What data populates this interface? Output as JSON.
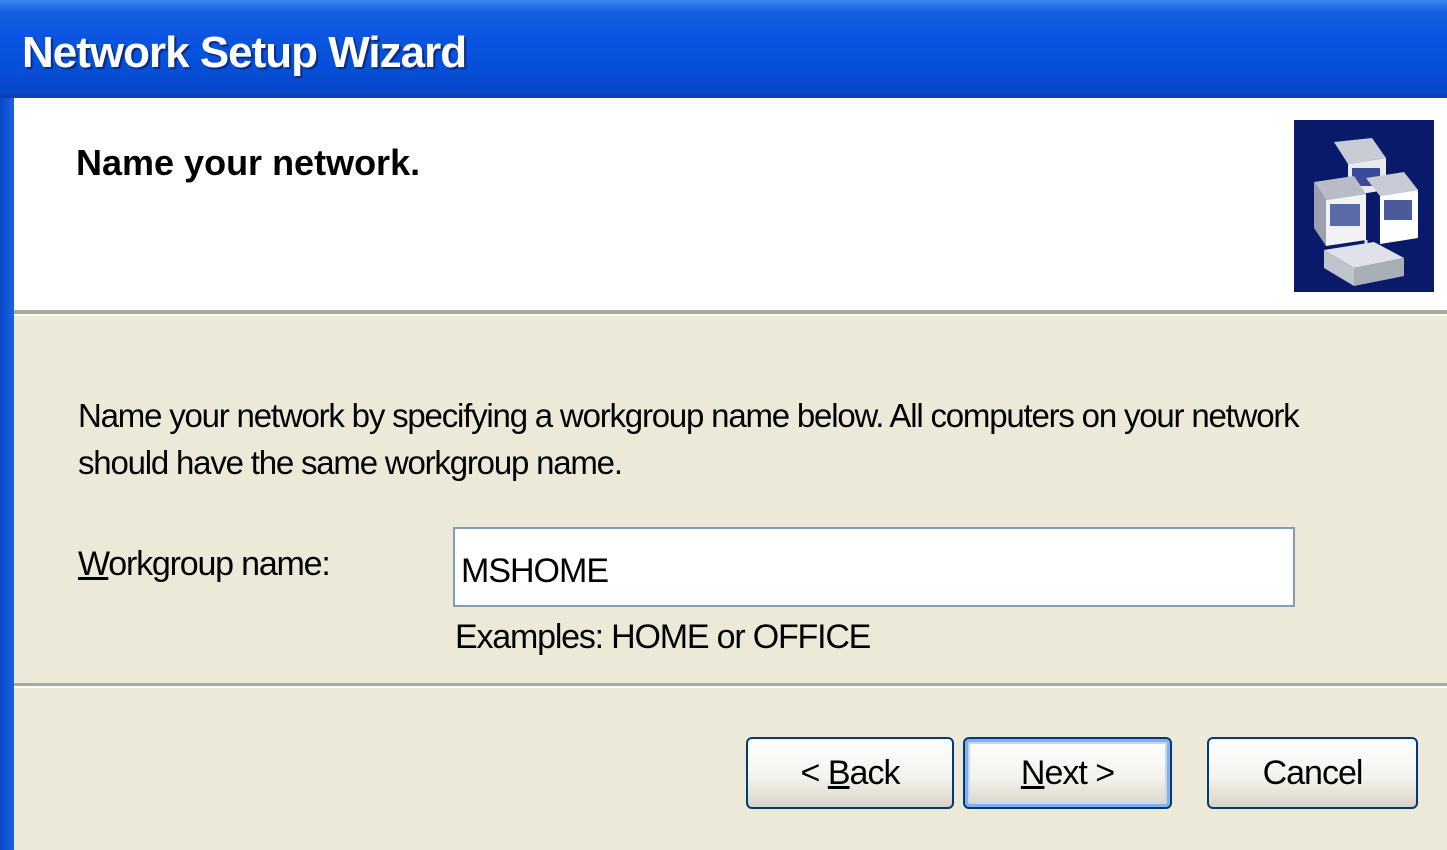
{
  "window": {
    "title": "Network Setup Wizard"
  },
  "header": {
    "title": "Name your network.",
    "icon": "network-computers-icon"
  },
  "body": {
    "description": "Name your network by specifying a workgroup name below. All computers on your network should have the same workgroup name.",
    "workgroup_label_mnemonic": "W",
    "workgroup_label_rest": "orkgroup name:",
    "workgroup_value": "MSHOME",
    "examples": "Examples: HOME or OFFICE"
  },
  "buttons": {
    "back_prefix": "< ",
    "back_mnemonic": "B",
    "back_rest": "ack",
    "next_mnemonic": "N",
    "next_rest": "ext >",
    "cancel": "Cancel"
  },
  "colors": {
    "titlebar": "#0550d8",
    "dialog_bg": "#ece9d8",
    "header_bg": "#ffffff",
    "button_border": "#003c74",
    "input_border": "#7f9db9"
  }
}
